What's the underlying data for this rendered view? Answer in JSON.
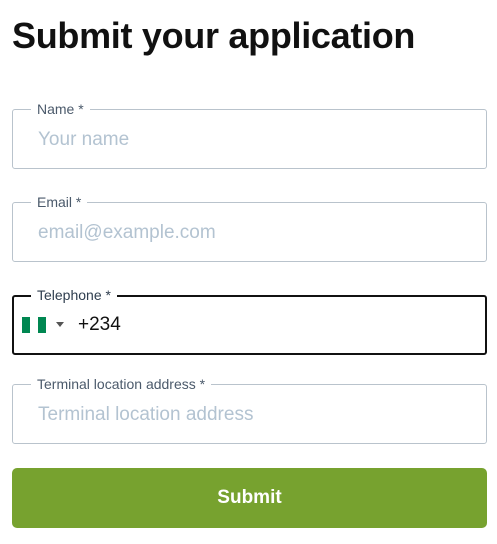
{
  "form": {
    "title": "Submit your application",
    "fields": {
      "name": {
        "label": "Name *",
        "placeholder": "Your name",
        "value": ""
      },
      "email": {
        "label": "Email *",
        "placeholder": "email@example.com",
        "value": ""
      },
      "telephone": {
        "label": "Telephone *",
        "country_flag": "nigeria-flag-icon",
        "dial_code": "+234"
      },
      "terminal_address": {
        "label": "Terminal location address *",
        "placeholder": "Terminal location address",
        "value": ""
      }
    },
    "submit_label": "Submit",
    "colors": {
      "accent": "#77a22f",
      "focused_border": "#111111",
      "border": "#b9c3cc",
      "placeholder": "#b3c3d1",
      "flag_green": "#008751"
    }
  }
}
